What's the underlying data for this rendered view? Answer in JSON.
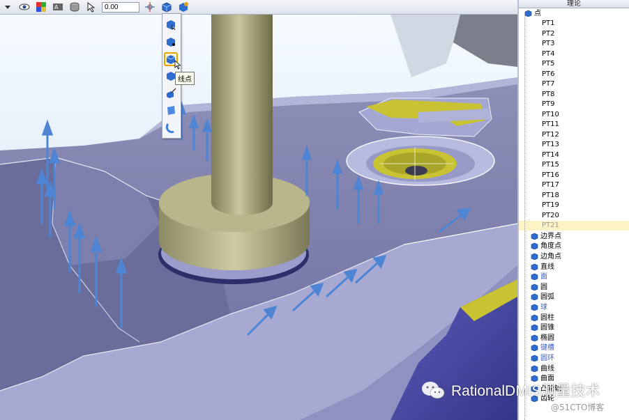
{
  "toolbar": {
    "tolerance_value": "0.00",
    "buttons": [
      "view-icon",
      "color-icon",
      "label-icon",
      "layer-icon",
      "select-icon",
      "measure-icon",
      "point-type-icon",
      "settings-icon"
    ]
  },
  "dropdown": {
    "items": [
      "surface-point-icon",
      "edge-point-icon",
      "line-point-icon",
      "angle-point-icon",
      "vector-point-icon",
      "face-point-icon",
      "arc-point-icon"
    ],
    "selected_index": 2,
    "tooltip": "线点"
  },
  "tree": {
    "header": "理论",
    "root_label": "点",
    "points": [
      "PT1",
      "PT2",
      "PT3",
      "PT4",
      "PT5",
      "PT6",
      "PT7",
      "PT8",
      "PT9",
      "PT10",
      "PT11",
      "PT12",
      "PT13",
      "PT14",
      "PT15",
      "PT16",
      "PT17",
      "PT18",
      "PT19",
      "PT20",
      "PT21"
    ],
    "features": [
      "边界点",
      "角度点",
      "边角点",
      "直线",
      "面",
      "圆",
      "圆弧",
      "球",
      "圆柱",
      "圆锥",
      "椭圆",
      "键槽",
      "圆环",
      "曲线",
      "曲面",
      "凸轮轴",
      "齿轮"
    ]
  },
  "watermark": {
    "text": "RationalDMIS测量技术",
    "blog": "@51CTO博客"
  },
  "colors": {
    "part": "#8d8fbf",
    "cylinder": "#b7b48c",
    "arrow": "#4d84d4",
    "yellow": "#c9c233",
    "sky": "#d5e6f5"
  }
}
